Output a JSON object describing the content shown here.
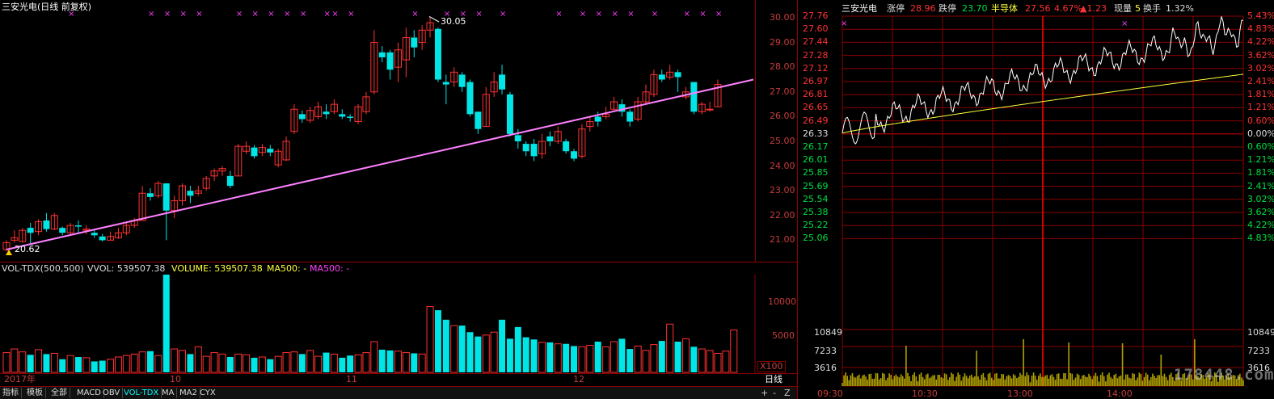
{
  "kline": {
    "title": "三安光电(日线 前复权)",
    "high_label": "30.05",
    "low_label": "20.62",
    "y_ticks": [
      "30.00",
      "29.00",
      "28.00",
      "27.00",
      "26.00",
      "25.00",
      "24.00",
      "23.00",
      "22.00",
      "21.00"
    ],
    "x_labels": [
      "2017年",
      "10",
      "11",
      "12"
    ],
    "period_label": "日线",
    "vol_header": {
      "name": "VOL-TDX(500,500)",
      "vvol": "VVOL: 539507.38",
      "volume": "VOLUME: 539507.38",
      "ma500a": "MA500: -",
      "ma500b": "MA500: -"
    },
    "vol_ticks": [
      "10000",
      "5000"
    ],
    "vol_unit": "X100",
    "candles": [
      [
        20.62,
        20.9,
        21.0,
        20.55
      ],
      [
        21.0,
        21.1,
        21.4,
        20.9
      ],
      [
        20.95,
        21.4,
        21.5,
        20.9
      ],
      [
        21.5,
        21.3,
        21.7,
        20.8
      ],
      [
        21.35,
        21.75,
        21.85,
        21.2
      ],
      [
        21.8,
        21.45,
        22.1,
        21.35
      ],
      [
        21.45,
        22.0,
        22.1,
        21.4
      ],
      [
        21.5,
        21.3,
        21.55,
        21.2
      ],
      [
        21.3,
        21.6,
        21.7,
        21.2
      ],
      [
        21.6,
        21.55,
        21.8,
        21.3
      ],
      [
        21.4,
        21.45,
        21.6,
        21.25
      ],
      [
        21.3,
        21.2,
        21.45,
        21.1
      ],
      [
        21.15,
        21.0,
        21.25,
        20.95
      ],
      [
        21.0,
        21.15,
        21.35,
        21.0
      ],
      [
        21.1,
        21.3,
        21.5,
        21.05
      ],
      [
        21.3,
        21.6,
        21.7,
        21.2
      ],
      [
        21.6,
        21.8,
        21.9,
        21.5
      ],
      [
        21.8,
        22.9,
        23.2,
        21.8
      ],
      [
        22.9,
        22.75,
        23.1,
        22.6
      ],
      [
        22.8,
        23.3,
        23.4,
        22.7
      ],
      [
        23.3,
        22.2,
        23.3,
        21.0
      ],
      [
        22.2,
        22.6,
        22.8,
        21.9
      ],
      [
        22.6,
        23.2,
        23.3,
        22.4
      ],
      [
        23.0,
        22.8,
        23.2,
        22.5
      ],
      [
        22.9,
        23.0,
        23.2,
        22.8
      ],
      [
        23.1,
        23.5,
        23.6,
        23.0
      ],
      [
        23.6,
        23.8,
        23.9,
        23.4
      ],
      [
        23.8,
        23.9,
        24.0,
        23.6
      ],
      [
        23.6,
        23.2,
        23.8,
        23.1
      ],
      [
        23.6,
        24.8,
        24.9,
        23.6
      ],
      [
        24.6,
        24.8,
        25.0,
        24.5
      ],
      [
        24.75,
        24.4,
        24.85,
        24.3
      ],
      [
        24.55,
        24.75,
        24.9,
        24.4
      ],
      [
        24.7,
        24.55,
        24.85,
        24.4
      ],
      [
        24.05,
        24.6,
        24.7,
        23.95
      ],
      [
        24.25,
        25.0,
        25.2,
        24.2
      ],
      [
        25.4,
        26.3,
        26.5,
        25.3
      ],
      [
        26.1,
        25.9,
        26.25,
        25.75
      ],
      [
        25.85,
        26.25,
        26.4,
        25.75
      ],
      [
        26.0,
        26.4,
        26.6,
        25.9
      ],
      [
        26.2,
        26.1,
        26.5,
        25.9
      ],
      [
        26.2,
        26.5,
        26.7,
        26.1
      ],
      [
        26.1,
        26.0,
        26.3,
        25.9
      ],
      [
        26.0,
        25.95,
        26.1,
        25.8
      ],
      [
        25.8,
        26.4,
        26.5,
        25.7
      ],
      [
        26.2,
        26.8,
        27.0,
        26.1
      ],
      [
        27.0,
        29.0,
        29.5,
        26.9
      ],
      [
        28.6,
        28.4,
        28.85,
        28.2
      ],
      [
        28.6,
        27.9,
        28.7,
        27.5
      ],
      [
        28.0,
        28.7,
        29.0,
        27.4
      ],
      [
        28.3,
        29.2,
        29.6,
        27.6
      ],
      [
        29.2,
        28.8,
        29.5,
        28.4
      ],
      [
        29.0,
        29.5,
        29.7,
        28.7
      ],
      [
        29.5,
        29.8,
        30.05,
        29.2
      ],
      [
        29.55,
        27.5,
        29.6,
        27.4
      ],
      [
        27.4,
        27.3,
        27.7,
        26.5
      ],
      [
        27.4,
        27.8,
        28.0,
        27.2
      ],
      [
        27.7,
        27.2,
        27.8,
        27.0
      ],
      [
        27.4,
        26.1,
        27.5,
        26.0
      ],
      [
        26.2,
        25.5,
        26.2,
        25.3
      ],
      [
        25.6,
        26.9,
        27.2,
        25.6
      ],
      [
        27.0,
        27.4,
        27.8,
        26.8
      ],
      [
        27.7,
        27.1,
        28.1,
        26.9
      ],
      [
        26.9,
        25.3,
        27.0,
        25.2
      ],
      [
        25.25,
        25.0,
        25.5,
        24.7
      ],
      [
        24.9,
        24.6,
        25.0,
        24.4
      ],
      [
        24.9,
        24.4,
        25.1,
        24.2
      ],
      [
        24.5,
        25.0,
        25.3,
        24.3
      ],
      [
        25.2,
        25.0,
        25.4,
        24.8
      ],
      [
        25.0,
        25.4,
        25.6,
        24.9
      ],
      [
        25.0,
        24.6,
        25.1,
        24.5
      ],
      [
        24.6,
        24.3,
        24.7,
        24.2
      ],
      [
        24.4,
        25.5,
        25.7,
        24.3
      ],
      [
        25.6,
        25.8,
        26.0,
        25.4
      ],
      [
        26.0,
        25.8,
        26.2,
        25.6
      ],
      [
        26.0,
        26.1,
        26.4,
        25.9
      ],
      [
        26.3,
        26.6,
        26.8,
        26.2
      ],
      [
        26.5,
        26.2,
        26.7,
        26.0
      ],
      [
        26.2,
        25.8,
        26.3,
        25.6
      ],
      [
        25.9,
        26.6,
        26.8,
        25.8
      ],
      [
        26.6,
        27.0,
        27.3,
        26.5
      ],
      [
        26.9,
        27.7,
        27.9,
        26.8
      ],
      [
        27.7,
        27.5,
        27.9,
        27.4
      ],
      [
        27.6,
        27.8,
        28.1,
        27.5
      ],
      [
        27.8,
        27.6,
        27.9,
        27.0
      ],
      [
        26.8,
        27.0,
        27.2,
        26.7
      ],
      [
        27.4,
        26.2,
        27.4,
        26.1
      ],
      [
        26.2,
        26.5,
        26.6,
        26.1
      ],
      [
        26.3,
        26.3,
        26.6,
        26.2
      ],
      [
        26.4,
        27.3,
        27.5,
        26.4
      ]
    ],
    "volumes": [
      2700,
      3200,
      2800,
      2400,
      3100,
      2500,
      2600,
      1800,
      2300,
      2100,
      2000,
      1500,
      1600,
      1800,
      2100,
      2300,
      2500,
      2800,
      2900,
      2300,
      13400,
      3200,
      3000,
      2500,
      3500,
      2200,
      2700,
      2500,
      2100,
      2500,
      2400,
      2000,
      2100,
      1800,
      2200,
      2700,
      2800,
      2500,
      3000,
      2200,
      2700,
      2500,
      2000,
      2300,
      2400,
      2700,
      4200,
      3100,
      3000,
      2900,
      2700,
      2600,
      2500,
      9000,
      8500,
      7200,
      6400,
      6400,
      5500,
      4900,
      5100,
      5500,
      7200,
      4600,
      6200,
      4800,
      4500,
      4100,
      4100,
      3900,
      3900,
      3600,
      3500,
      3700,
      4200,
      3500,
      4200,
      4600,
      3200,
      3600,
      3000,
      3800,
      4300,
      6600,
      4200,
      4600,
      3500,
      3200,
      3000,
      2600,
      2900,
      5800
    ]
  },
  "intraday": {
    "header": {
      "name": "三安光电",
      "limit_up_label": "涨停",
      "limit_up_value": "28.96",
      "limit_down_label": "跌停",
      "limit_down_value": "23.70",
      "sector": "半导体",
      "last_price": "27.56",
      "pct": "4.67%",
      "change": "▲1.23",
      "now_vol_label": "现量",
      "now_vol": "5",
      "turnover_label": "换手",
      "turnover": "1.32%"
    },
    "price_ticks": [
      "27.76",
      "27.60",
      "27.44",
      "27.28",
      "27.12",
      "26.97",
      "26.81",
      "26.65",
      "26.49",
      "26.33",
      "26.17",
      "26.01",
      "25.85",
      "25.69",
      "25.54",
      "25.38",
      "25.22",
      "25.06"
    ],
    "pct_ticks": [
      "5.43%",
      "4.83%",
      "4.22%",
      "3.62%",
      "3.02%",
      "2.41%",
      "1.81%",
      "1.21%",
      "0.60%",
      "0.00%",
      "0.60%",
      "1.21%",
      "1.81%",
      "2.41%",
      "3.02%",
      "3.62%",
      "4.22%",
      "4.83%"
    ],
    "vol_ticks": [
      "10849",
      "7233",
      "3616"
    ],
    "time_labels": [
      "09:30",
      "10:30",
      "13:00",
      "14:00"
    ],
    "watermark": "178448.com"
  },
  "toolbar": {
    "tabs": [
      "指标",
      "模板",
      "全部",
      "MACD",
      "OBV",
      "VOL-TDX",
      "MA",
      "MA2",
      "CYX"
    ],
    "active": "VOL-TDX",
    "plus": "+",
    "minus": "-",
    "z": "Z"
  },
  "colors": {
    "up": "#ff3232",
    "down": "#00e5e5",
    "trend": "#ff80ff",
    "marker": "#ff40ff",
    "grid": "#8a0000",
    "label": "#c83c3c"
  }
}
